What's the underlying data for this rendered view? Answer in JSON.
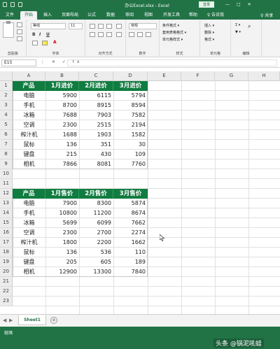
{
  "window": {
    "title": "办公Excel.xlsx  -  Excel",
    "login_label": "登录",
    "min_glyph": "—",
    "max_glyph": "□",
    "close_glyph": "✕"
  },
  "tabs": {
    "items": [
      "文件",
      "开始",
      "插入",
      "页面布局",
      "公式",
      "数据",
      "审阅",
      "视图",
      "开发工具",
      "帮助"
    ],
    "tell_me": "♀ 告诉我",
    "share": "♀ 共享"
  },
  "ribbon": {
    "groups": {
      "clipboard": "剪贴板",
      "font": "字体",
      "alignment": "对齐方式",
      "number": "数字",
      "styles": "样式",
      "cells": "单元格",
      "editing": "编辑"
    },
    "font_name": "等线",
    "font_size": "11",
    "number_format": "常规",
    "bold": "B",
    "italic": "I",
    "underline": "U",
    "font_color": "A",
    "styles_cmds": [
      "条件格式 ▾",
      "套用表格格式 ▾",
      "单元格样式 ▾"
    ],
    "cells_cmds": [
      "插入 ▾",
      "删除 ▾",
      "格式 ▾"
    ],
    "editing_cmds": [
      "Σ ▾",
      "▼ ▾",
      "⌕"
    ]
  },
  "formula_bar": {
    "name_box": "E15",
    "fx_symbols": "⋮ ✕ ✓ fx",
    "value": ""
  },
  "columns": [
    "A",
    "B",
    "C",
    "D",
    "E",
    "F",
    "G",
    "H"
  ],
  "rows": [
    "1",
    "2",
    "3",
    "4",
    "5",
    "6",
    "7",
    "8",
    "9",
    "10",
    "11",
    "12",
    "13",
    "14",
    "15",
    "16",
    "17",
    "18",
    "19",
    "20",
    "21",
    "22",
    "23"
  ],
  "table1": {
    "headers": [
      "产品",
      "1月进价",
      "2月进价",
      "3月进价"
    ],
    "rows": [
      [
        "电脑",
        "5900",
        "6115",
        "5794"
      ],
      [
        "手机",
        "8700",
        "8915",
        "8594"
      ],
      [
        "冰箱",
        "7688",
        "7903",
        "7582"
      ],
      [
        "空调",
        "2300",
        "2515",
        "2194"
      ],
      [
        "榨汁机",
        "1688",
        "1903",
        "1582"
      ],
      [
        "鼠标",
        "136",
        "351",
        "30"
      ],
      [
        "键盘",
        "215",
        "430",
        "109"
      ],
      [
        "相机",
        "7866",
        "8081",
        "7760"
      ]
    ]
  },
  "table2": {
    "headers": [
      "产品",
      "1月售价",
      "2月售价",
      "3月售价"
    ],
    "rows": [
      [
        "电脑",
        "7900",
        "8300",
        "5874"
      ],
      [
        "手机",
        "10800",
        "11200",
        "8674"
      ],
      [
        "冰箱",
        "5699",
        "6099",
        "7662"
      ],
      [
        "空调",
        "2300",
        "2700",
        "2274"
      ],
      [
        "榨汁机",
        "1800",
        "2200",
        "1662"
      ],
      [
        "鼠标",
        "136",
        "536",
        "110"
      ],
      [
        "键盘",
        "205",
        "605",
        "189"
      ],
      [
        "相机",
        "12900",
        "13300",
        "7840"
      ]
    ]
  },
  "sheet_tabs": {
    "active": "Sheet1",
    "add_glyph": "+",
    "nav_glyphs": [
      "◀",
      "▶"
    ]
  },
  "status": {
    "ready": "就绪"
  },
  "watermark": "头条 @锅泥吼蛙"
}
